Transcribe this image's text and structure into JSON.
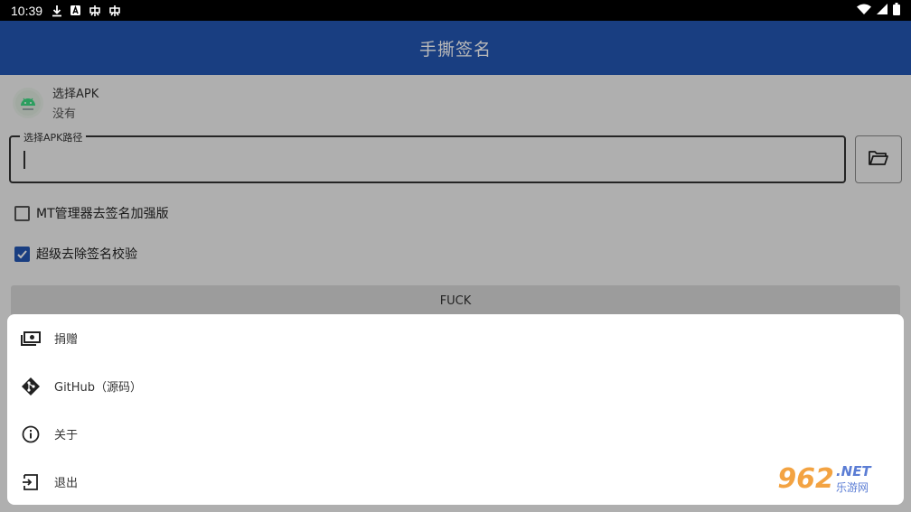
{
  "status_bar": {
    "time": "10:39"
  },
  "app_bar": {
    "title": "手撕签名"
  },
  "apk": {
    "label": "选择APK",
    "value": "没有"
  },
  "path_field": {
    "legend": "选择APK路径",
    "value": ""
  },
  "options": [
    {
      "label": "MT管理器去签名加强版",
      "checked": false
    },
    {
      "label": "超级去除签名校验",
      "checked": true
    }
  ],
  "action_button": {
    "label": "FUCK"
  },
  "menu": [
    {
      "label": "捐赠",
      "icon": "money-icon"
    },
    {
      "label": "GitHub（源码）",
      "icon": "git-icon"
    },
    {
      "label": "关于",
      "icon": "info-icon"
    },
    {
      "label": "退出",
      "icon": "exit-icon"
    }
  ],
  "watermark": {
    "number": "962",
    "suffix": ".NET",
    "cn": "乐游网"
  },
  "colors": {
    "primary": "#2356b3",
    "checkbox": "#2356b3"
  }
}
